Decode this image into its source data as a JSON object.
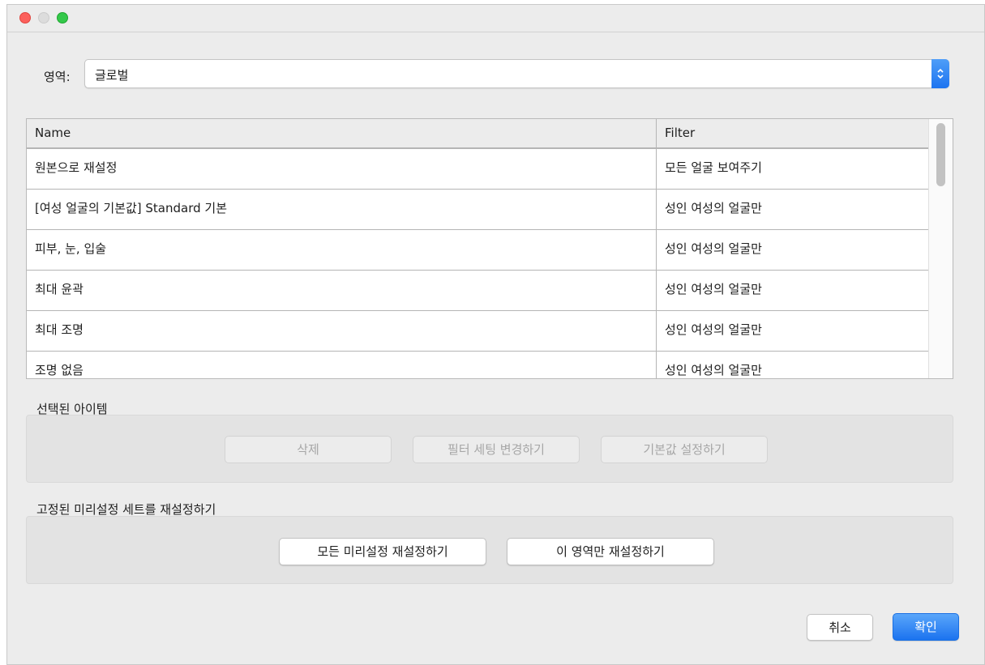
{
  "window": {
    "buttons": {
      "close": "close-button",
      "minimize": "minimize-button",
      "zoom": "zoom-button"
    }
  },
  "region": {
    "label": "영역:",
    "selected": "글로벌",
    "stepper_icon": "chevron-updown-icon"
  },
  "table": {
    "columns": [
      "Name",
      "Filter"
    ],
    "rows": [
      {
        "name": "원본으로 재설정",
        "filter": "모든 얼굴 보여주기"
      },
      {
        "name": "[여성 얼굴의 기본값] Standard 기본",
        "filter": "성인 여성의 얼굴만"
      },
      {
        "name": "피부, 눈, 입술",
        "filter": "성인 여성의 얼굴만"
      },
      {
        "name": "최대 윤곽",
        "filter": "성인 여성의 얼굴만"
      },
      {
        "name": "최대 조명",
        "filter": "성인 여성의 얼굴만"
      },
      {
        "name": "조명 없음",
        "filter": "성인 여성의 얼굴만"
      }
    ]
  },
  "selected_items": {
    "title": "선택된 아이템",
    "delete_label": "삭제",
    "change_filter_label": "필터 세팅 변경하기",
    "set_default_label": "기본값 설정하기"
  },
  "reset_presets": {
    "title": "고정된 미리설정 세트를 재설정하기",
    "reset_all_label": "모든 미리설정 재설정하기",
    "reset_region_label": "이 영역만 재설정하기"
  },
  "footer": {
    "cancel_label": "취소",
    "ok_label": "확인"
  },
  "colors": {
    "accent": "#1d74f0",
    "close": "#fc605c",
    "zoom": "#34c84a"
  }
}
